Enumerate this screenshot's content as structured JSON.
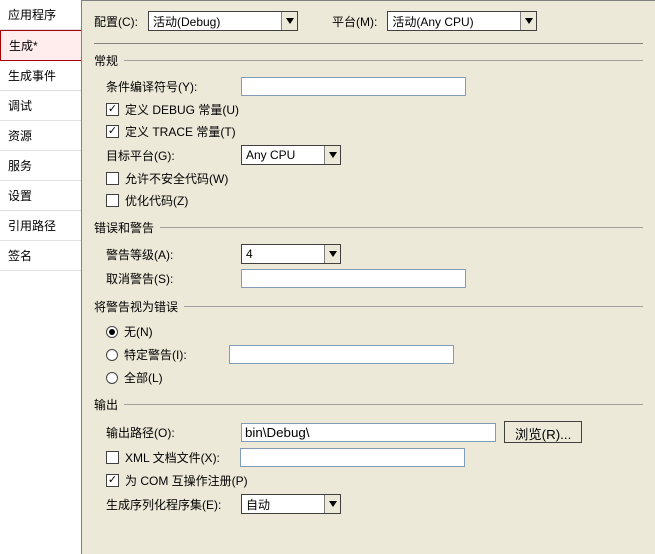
{
  "sidebar": {
    "items": [
      {
        "label": "应用程序"
      },
      {
        "label": "生成*"
      },
      {
        "label": "生成事件"
      },
      {
        "label": "调试"
      },
      {
        "label": "资源"
      },
      {
        "label": "服务"
      },
      {
        "label": "设置"
      },
      {
        "label": "引用路径"
      },
      {
        "label": "签名"
      }
    ]
  },
  "top": {
    "config_label": "配置(C):",
    "config_value": "活动(Debug)",
    "platform_label": "平台(M):",
    "platform_value": "活动(Any CPU)"
  },
  "general": {
    "title": "常规",
    "cond_label": "条件编译符号(Y):",
    "cond_value": "",
    "debug_label": "定义 DEBUG 常量(U)",
    "trace_label": "定义 TRACE 常量(T)",
    "target_label": "目标平台(G):",
    "target_value": "Any CPU",
    "unsafe_label": "允许不安全代码(W)",
    "optimize_label": "优化代码(Z)"
  },
  "errors": {
    "title": "错误和警告",
    "level_label": "警告等级(A):",
    "level_value": "4",
    "suppress_label": "取消警告(S):",
    "suppress_value": ""
  },
  "treat": {
    "title": "将警告视为错误",
    "none_label": "无(N)",
    "specific_label": "特定警告(I):",
    "specific_value": "",
    "all_label": "全部(L)"
  },
  "output": {
    "title": "输出",
    "path_label": "输出路径(O):",
    "path_value": "bin\\Debug\\",
    "browse_label": "浏览(R)...",
    "xml_label": "XML 文档文件(X):",
    "xml_value": "",
    "com_label": "为 COM 互操作注册(P)",
    "serial_label": "生成序列化程序集(E):",
    "serial_value": "自动"
  }
}
